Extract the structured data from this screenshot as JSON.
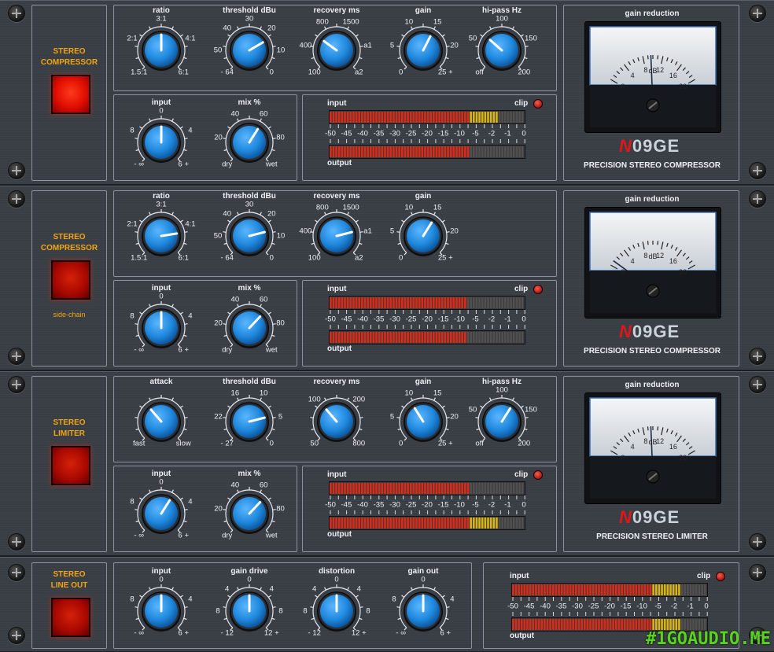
{
  "colors": {
    "accent_orange": "#f2a413",
    "knob_blue": "#1f88dd",
    "led_red": "#e01010",
    "meter_red": "#d82c1b",
    "meter_yellow": "#d8b515"
  },
  "meter_scale": [
    "-50",
    "-45",
    "-40",
    "-35",
    "-30",
    "-25",
    "-20",
    "-15",
    "-10",
    "-5",
    "-2",
    "-1",
    "0"
  ],
  "rows": [
    {
      "switch": {
        "title": "STEREO\nCOMPRESSOR",
        "sub": ""
      },
      "top_knobs": [
        {
          "label": "ratio",
          "scale": [
            "1.5:1",
            "2:1",
            "3:1",
            "4:1",
            "6:1"
          ],
          "value": 0.5
        },
        {
          "label": "threshold dBu",
          "scale": [
            "- 64",
            "50",
            "40",
            "30",
            "20",
            "10",
            "0"
          ],
          "value": 0.72
        },
        {
          "label": "recovery ms",
          "scale": [
            "100",
            "400",
            "800",
            "1500",
            "a1",
            "a2"
          ],
          "value": 0.3
        },
        {
          "label": "gain",
          "scale": [
            "0",
            "5",
            "10",
            "15",
            "20",
            "25 +"
          ],
          "value": 0.6
        },
        {
          "label": "hi-pass Hz",
          "scale": [
            "off",
            "50",
            "100",
            "150",
            "200"
          ],
          "value": 0.32
        }
      ],
      "bottom_knobs": [
        {
          "label": "input",
          "scale": [
            "- ∞",
            "8",
            "0",
            "4",
            "6 +"
          ],
          "value": 0.5
        },
        {
          "label": "mix %",
          "scale": [
            "dry",
            "20",
            "40",
            "60",
            "80",
            "wet"
          ],
          "value": 0.62
        }
      ],
      "meters": {
        "input_label": "input",
        "output_label": "output",
        "clip_label": "clip",
        "input_level": 0.86,
        "output_level": 0.72
      },
      "gain_reduction": {
        "title": "gain reduction",
        "ticks": [
          "0",
          "4",
          "8",
          "12",
          "16",
          "20"
        ],
        "unit": "dB",
        "needle": 0.48
      },
      "model": "PRECISION STEREO COMPRESSOR"
    },
    {
      "switch": {
        "title": "STEREO\nCOMPRESSOR",
        "sub": "side-chain"
      },
      "top_knobs": [
        {
          "label": "ratio",
          "scale": [
            "1.5:1",
            "2:1",
            "3:1",
            "4:1",
            "6:1"
          ],
          "value": 0.8
        },
        {
          "label": "threshold dBu",
          "scale": [
            "- 64",
            "50",
            "40",
            "30",
            "20",
            "10",
            "0"
          ],
          "value": 0.78
        },
        {
          "label": "recovery ms",
          "scale": [
            "100",
            "400",
            "800",
            "1500",
            "a1",
            "a2"
          ],
          "value": 0.78
        },
        {
          "label": "gain",
          "scale": [
            "0",
            "5",
            "10",
            "15",
            "20",
            "25 +"
          ],
          "value": 0.62
        }
      ],
      "bottom_knobs": [
        {
          "label": "input",
          "scale": [
            "- ∞",
            "8",
            "0",
            "4",
            "6 +"
          ],
          "value": 0.5
        },
        {
          "label": "mix %",
          "scale": [
            "dry",
            "20",
            "40",
            "60",
            "80",
            "wet"
          ],
          "value": 0.66
        }
      ],
      "meters": {
        "input_label": "input",
        "output_label": "output",
        "clip_label": "clip",
        "input_level": 0.7,
        "output_level": 0.7
      },
      "gain_reduction": {
        "title": "gain reduction",
        "ticks": [
          "0",
          "4",
          "8",
          "12",
          "16",
          "20"
        ],
        "unit": "dB",
        "needle": 0.05
      },
      "model": "PRECISION STEREO COMPRESSOR"
    },
    {
      "switch": {
        "title": "STEREO\nLIMITER",
        "sub": ""
      },
      "top_knobs": [
        {
          "label": "attack",
          "scale": [
            "fast",
            "slow"
          ],
          "value": 0.35
        },
        {
          "label": "threshold dBu",
          "scale": [
            "- 27",
            "22",
            "16",
            "10",
            "5",
            "0"
          ],
          "value": 0.78
        },
        {
          "label": "recovery ms",
          "scale": [
            "50",
            "100",
            "200",
            "800"
          ],
          "value": 0.35
        },
        {
          "label": "gain",
          "scale": [
            "0",
            "5",
            "10",
            "15",
            "20",
            "25 +"
          ],
          "value": 0.38
        },
        {
          "label": "hi-pass Hz",
          "scale": [
            "off",
            "50",
            "100",
            "150",
            "200"
          ],
          "value": 0.62
        }
      ],
      "bottom_knobs": [
        {
          "label": "input",
          "scale": [
            "- ∞",
            "8",
            "0",
            "4",
            "6 +"
          ],
          "value": 0.62
        },
        {
          "label": "mix %",
          "scale": [
            "dry",
            "20",
            "40",
            "60",
            "80",
            "wet"
          ],
          "value": 0.66
        }
      ],
      "meters": {
        "input_label": "input",
        "output_label": "output",
        "clip_label": "clip",
        "input_level": 0.72,
        "output_level": 0.86
      },
      "gain_reduction": {
        "title": "gain reduction",
        "ticks": [
          "0",
          "4",
          "8",
          "12",
          "16",
          "20"
        ],
        "unit": "dB",
        "needle": 0.48
      },
      "model": "PRECISION STEREO LIMITER"
    }
  ],
  "lineout": {
    "switch": {
      "title": "STEREO\nLINE OUT"
    },
    "knobs": [
      {
        "label": "input",
        "scale": [
          "- ∞",
          "8",
          "0",
          "4",
          "6 +"
        ],
        "value": 0.5
      },
      {
        "label": "gain drive",
        "scale": [
          "- 12",
          "8",
          "4",
          "0",
          "4",
          "8",
          "12 +"
        ],
        "value": 0.5
      },
      {
        "label": "distortion",
        "scale": [
          "- 12",
          "8",
          "4",
          "0",
          "4",
          "8",
          "12 +"
        ],
        "value": 0.5
      },
      {
        "label": "gain out",
        "scale": [
          "- ∞",
          "8",
          "0",
          "4",
          "6 +"
        ],
        "value": 0.5
      }
    ],
    "meters": {
      "input_label": "input",
      "output_label": "output",
      "clip_label": "clip",
      "input_level": 0.86,
      "output_level": 0.86
    }
  },
  "logo": {
    "mark": "N",
    "text": "09GE"
  },
  "watermark": "#1GOAUDIO.ME"
}
